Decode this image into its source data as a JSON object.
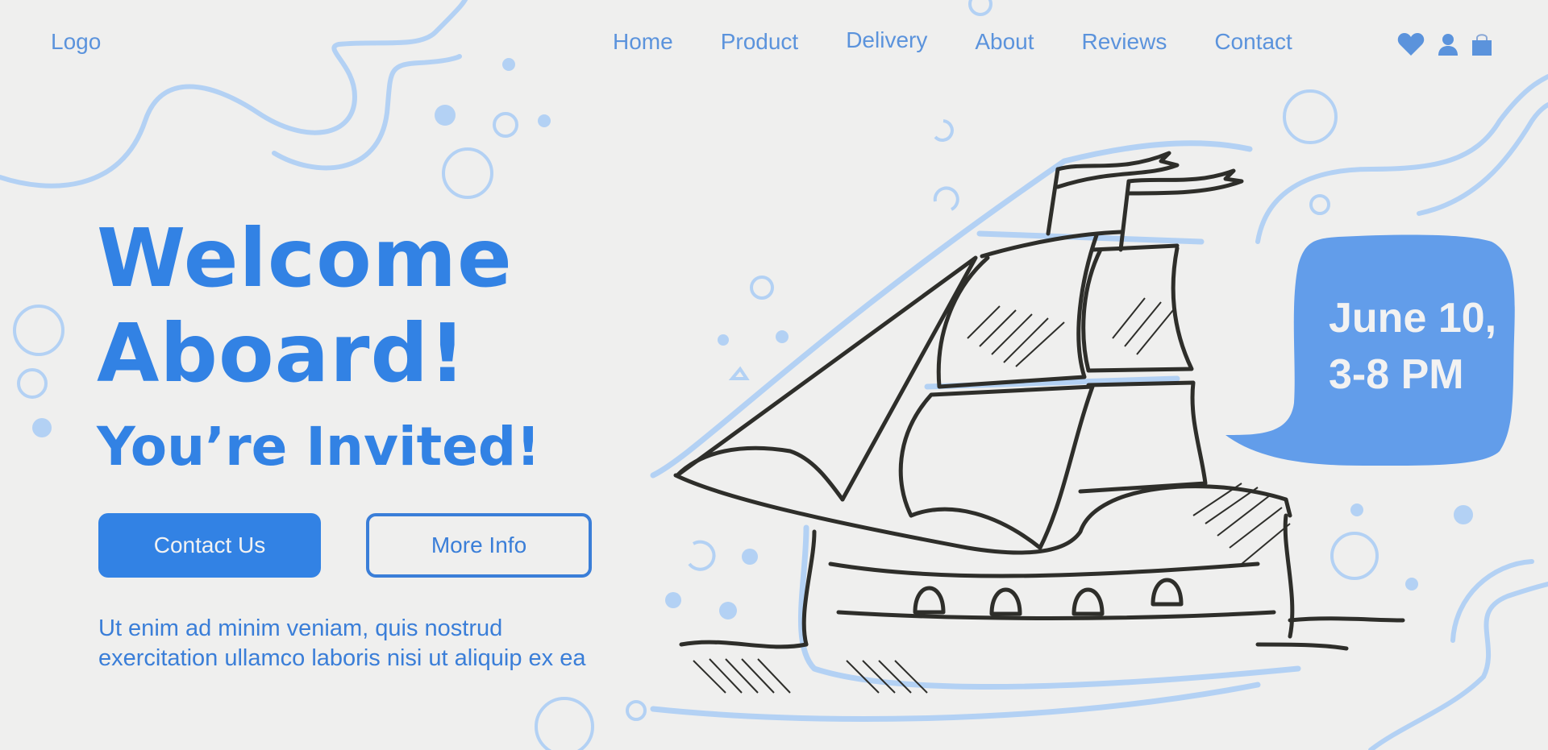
{
  "header": {
    "logo": "Logo",
    "nav": [
      {
        "label": "Home"
      },
      {
        "label": "Product"
      },
      {
        "label": "Delivery"
      },
      {
        "label": "About"
      },
      {
        "label": "Reviews"
      },
      {
        "label": "Contact"
      }
    ],
    "icons": [
      "heart-icon",
      "user-icon",
      "shopping-bag-icon"
    ]
  },
  "hero": {
    "headline_line1": "Welcome",
    "headline_line2": "Aboard!",
    "subheadline": "You’re Invited!",
    "primary_button": "Contact Us",
    "secondary_button": "More Info",
    "body_line1": "Ut enim ad minim veniam, quis nostrud",
    "body_line2": "exercitation ullamco laboris nisi ut aliquip ex ea"
  },
  "event_bubble": {
    "line1": "June 10,",
    "line2": "3-8 PM"
  },
  "illustration": {
    "subject": "sailing-ship"
  },
  "colors": {
    "background": "#efefee",
    "accent": "#3282e4",
    "nav_text": "#5b93dc",
    "bubble": "#629dea",
    "decor_light": "#b3d1f4",
    "ink": "#2e2e2a"
  }
}
